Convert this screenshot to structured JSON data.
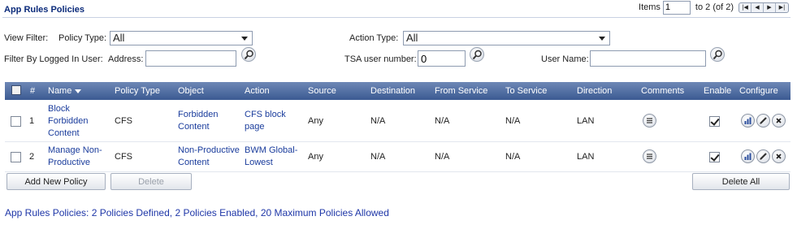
{
  "title": "App Rules Policies",
  "pager": {
    "items_label": "Items",
    "items_value": "1",
    "range_text": "to 2 (of 2)",
    "buttons": [
      "first",
      "prev",
      "next",
      "last"
    ]
  },
  "filters": {
    "view_filter_label": "View Filter:",
    "policy_type_label": "Policy Type:",
    "policy_type_value": "All",
    "action_type_label": "Action Type:",
    "action_type_value": "All",
    "logged_in_label": "Filter By Logged In User:",
    "address_label": "Address:",
    "address_value": "",
    "tsa_label": "TSA user number:",
    "tsa_value": "0",
    "user_name_label": "User Name:",
    "user_name_value": ""
  },
  "table": {
    "columns": [
      "#",
      "Name",
      "Policy Type",
      "Object",
      "Action",
      "Source",
      "Destination",
      "From Service",
      "To Service",
      "Direction",
      "Comments",
      "Enable",
      "Configure"
    ],
    "rows": [
      {
        "num": "1",
        "name": "Block Forbidden Content",
        "policy_type": "CFS",
        "object": "Forbidden Content",
        "action": "CFS block page",
        "source": "Any",
        "destination": "N/A",
        "from_service": "N/A",
        "to_service": "N/A",
        "direction": "LAN",
        "enabled": true
      },
      {
        "num": "2",
        "name": "Manage Non-Productive",
        "policy_type": "CFS",
        "object": "Non-Productive Content",
        "action": "BWM Global-Lowest",
        "source": "Any",
        "destination": "N/A",
        "from_service": "N/A",
        "to_service": "N/A",
        "direction": "LAN",
        "enabled": true
      }
    ]
  },
  "buttons": {
    "add": "Add New Policy",
    "delete": "Delete",
    "delete_all": "Delete All"
  },
  "summary": "App Rules Policies:  2 Policies Defined, 2 Policies Enabled, 20 Maximum Policies Allowed",
  "colors": {
    "accent": "#1a3c9c",
    "header_top": "#6e88b6",
    "header_bottom": "#3b5a92",
    "summary": "#1f37a8"
  }
}
